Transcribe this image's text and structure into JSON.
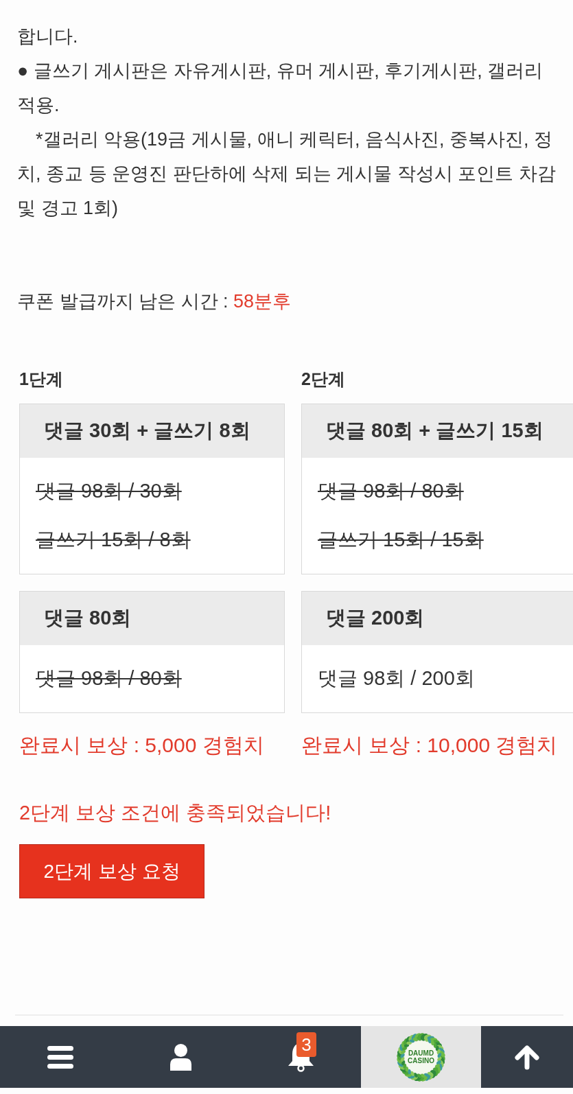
{
  "notes": [
    {
      "kind": "line",
      "text": "합니다."
    },
    {
      "kind": "line",
      "text": "● 글쓰기 게시판은 자유게시판, 유머 게시판, 후기게시판, 갤러리 적용."
    },
    {
      "kind": "note",
      "text": "*갤러리 악용(19금 게시물, 애니 케릭터, 음식사진, 중복사진, 정치, 종교 등 운영진 판단하에 삭제 되는 게시물 작성시 포인트 차감 및 경고 1회)"
    }
  ],
  "timer": {
    "label": "쿠폰 발급까지 남은 시간 :",
    "value": "58분후"
  },
  "stages": [
    {
      "title": "1단계",
      "missions": [
        {
          "heading": "댓글 30회 + 글쓰기 8회",
          "progress": [
            {
              "text": "댓글 98회 / 30회",
              "completed": true
            },
            {
              "text": "글쓰기 15회 / 8회",
              "completed": true
            }
          ]
        },
        {
          "heading": "댓글 80회",
          "progress": [
            {
              "text": "댓글 98회 / 80회",
              "completed": true
            }
          ]
        }
      ],
      "reward": "완료시 보상 : 5,000 경험치"
    },
    {
      "title": "2단계",
      "missions": [
        {
          "heading": "댓글 80회 + 글쓰기 15회",
          "progress": [
            {
              "text": "댓글 98회 / 80회",
              "completed": true
            },
            {
              "text": "글쓰기 15회 / 15회",
              "completed": true
            }
          ]
        },
        {
          "heading": "댓글 200회",
          "progress": [
            {
              "text": "댓글 98회 / 200회",
              "completed": false
            }
          ]
        }
      ],
      "reward": "완료시 보상 : 10,000 경험치"
    }
  ],
  "notice": "2단계 보상 조건에 충족되었습니다!",
  "claim_button": "2단계 보상 요청",
  "bottom_nav": [
    {
      "kind": "menu"
    },
    {
      "kind": "user"
    },
    {
      "kind": "bell",
      "badge": "3"
    },
    {
      "kind": "logo",
      "text": "DAUMD CASINO"
    },
    {
      "kind": "top"
    }
  ]
}
